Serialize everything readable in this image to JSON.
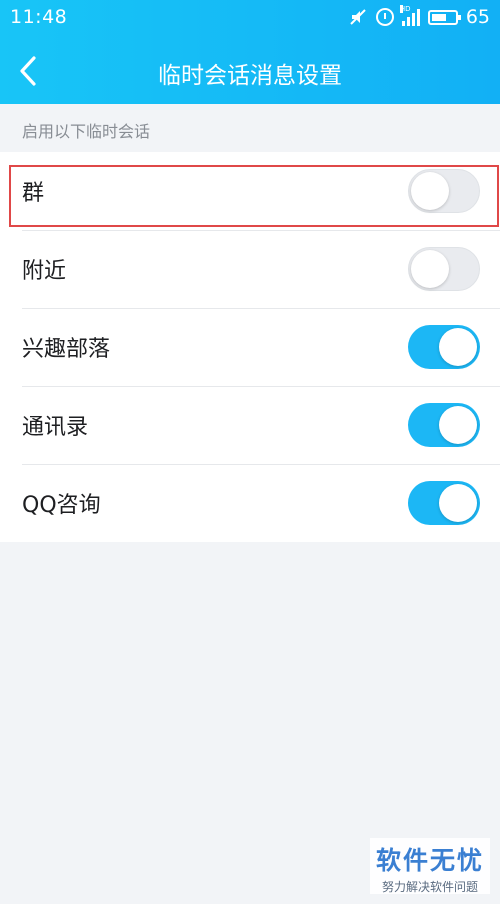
{
  "status_bar": {
    "time": "11:48",
    "signal_label": "HD",
    "battery": "65",
    "battery_level": 0.65
  },
  "header": {
    "title": "临时会话消息设置",
    "background_color": "#15bbf6"
  },
  "section_label": "启用以下临时会话",
  "settings": [
    {
      "label": "群",
      "enabled": false
    },
    {
      "label": "附近",
      "enabled": false
    },
    {
      "label": "兴趣部落",
      "enabled": true
    },
    {
      "label": "通讯录",
      "enabled": true
    },
    {
      "label": "QQ咨询",
      "enabled": true
    }
  ],
  "colors": {
    "toggle_on": "#1cb7f5",
    "toggle_off": "#e9ebef",
    "highlight": "#e04848"
  },
  "watermark": {
    "title": "软件无忧",
    "subtitle": "努力解决软件问题"
  },
  "icons": {
    "back": "chevron-left-icon",
    "muted": "mute-icon",
    "alarm": "alarm-icon",
    "signal": "signal-icon",
    "battery": "battery-icon"
  }
}
